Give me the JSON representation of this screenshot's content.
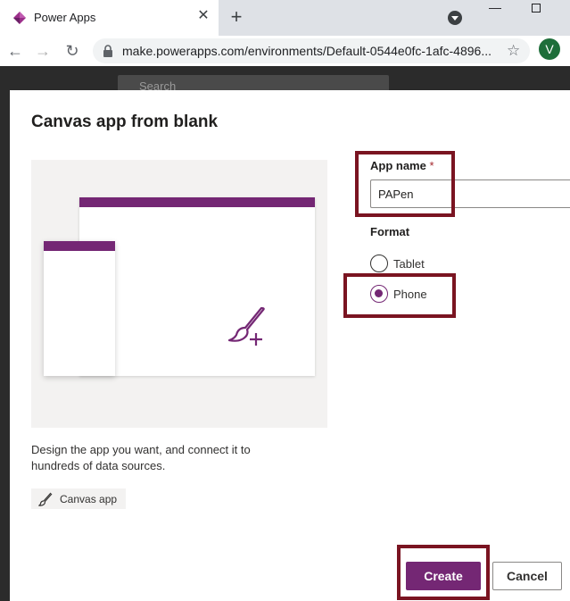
{
  "browser": {
    "tab_title": "Power Apps",
    "tab_close": "✕",
    "new_tab": "+",
    "url": "make.powerapps.com/environments/Default-0544e0fc-1afc-4896...",
    "profile_initial": "V",
    "icons": [
      "power-apps-favicon",
      "close-icon",
      "plus-icon",
      "tab-search-icon",
      "minimize-icon",
      "maximize-icon",
      "back-icon",
      "forward-icon",
      "reload-icon",
      "lock-icon",
      "star-icon"
    ]
  },
  "backdrop": {
    "search_placeholder": "Search"
  },
  "dialog": {
    "title": "Canvas app from blank",
    "description": "Design the app you want, and connect it to hundreds of data sources.",
    "chip_label": "Canvas app",
    "app_name_label": "App name",
    "required_marker": "*",
    "app_name_value": "PAPen",
    "format_label": "Format",
    "format_options": [
      {
        "label": "Tablet",
        "selected": false
      },
      {
        "label": "Phone",
        "selected": true
      }
    ],
    "create_label": "Create",
    "cancel_label": "Cancel"
  },
  "colors": {
    "accent": "#742774",
    "highlight_border": "#7a1421"
  }
}
